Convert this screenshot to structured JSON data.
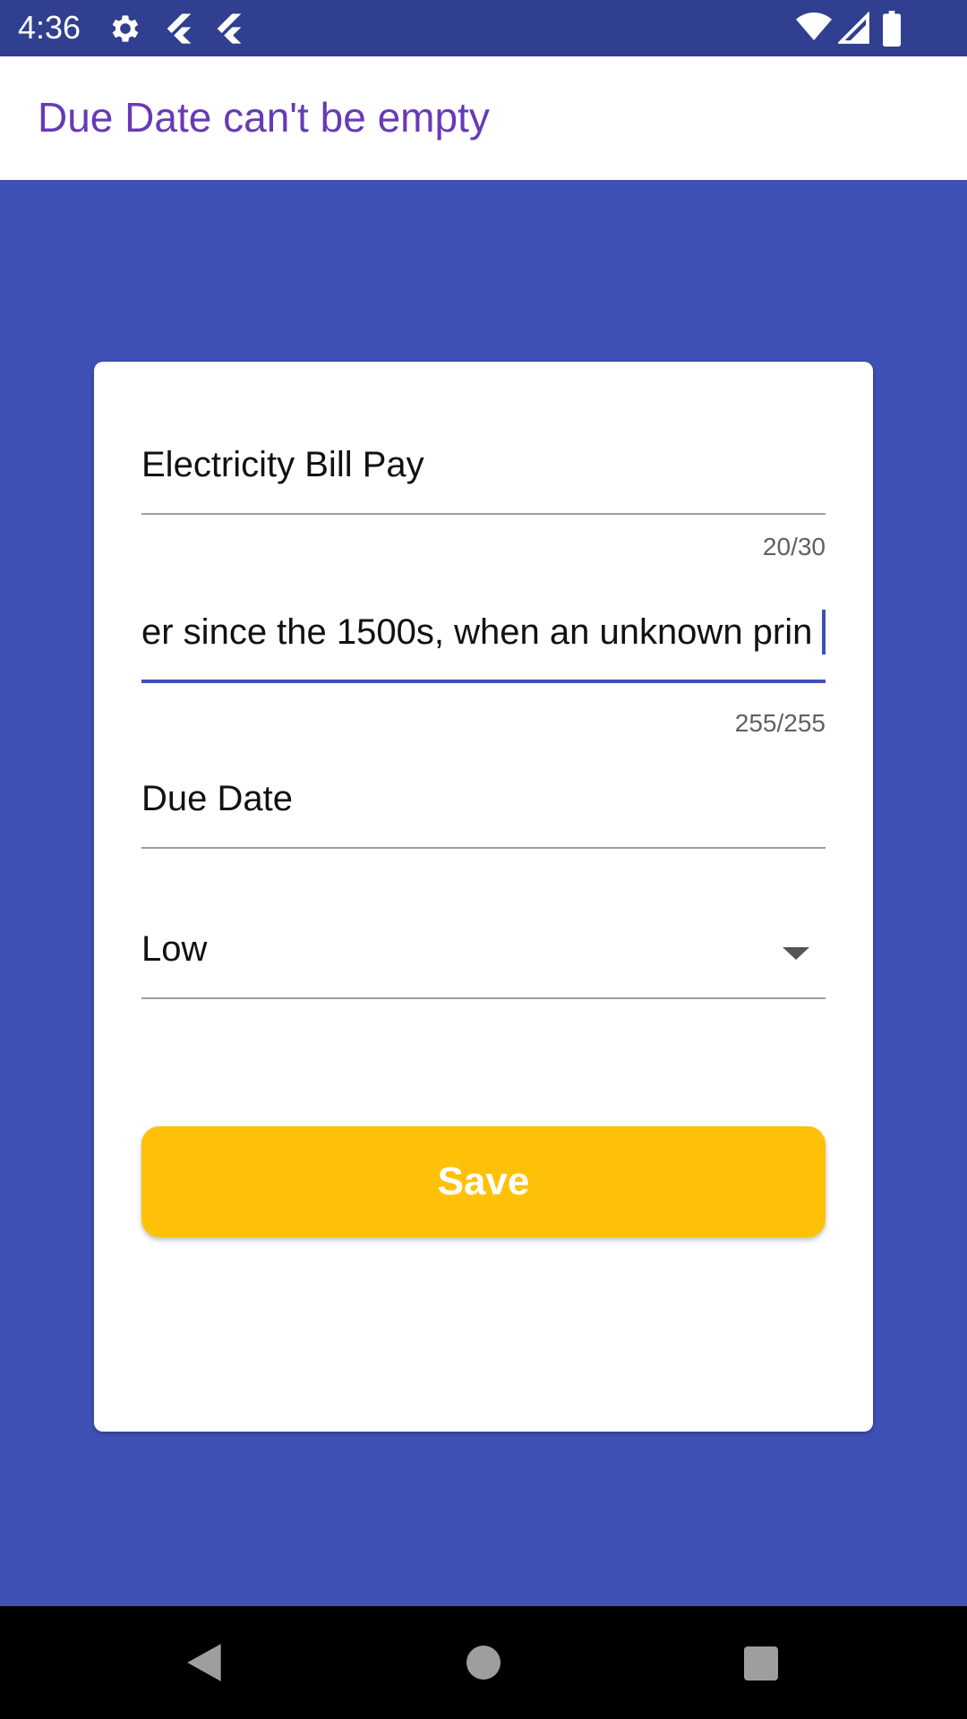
{
  "status_bar": {
    "time": "4:36",
    "icons": [
      "gear-icon",
      "flutter-icon",
      "flutter-icon",
      "wifi-icon",
      "signal-icon",
      "battery-icon"
    ]
  },
  "error_message": "Due Date can't be empty",
  "form": {
    "title": {
      "value": "Electricity Bill Pay",
      "counter": "20/30"
    },
    "description": {
      "value": "er since the 1500s, when an unknown prin",
      "counter": "255/255"
    },
    "due_date": {
      "placeholder": "Due Date"
    },
    "priority": {
      "selected": "Low"
    },
    "save_label": "Save"
  },
  "colors": {
    "background": "#3f51b5",
    "status_bar": "#303f8f",
    "error_text": "#673ab7",
    "save_button": "#ffc107",
    "focus_underline": "#3f51b5"
  }
}
